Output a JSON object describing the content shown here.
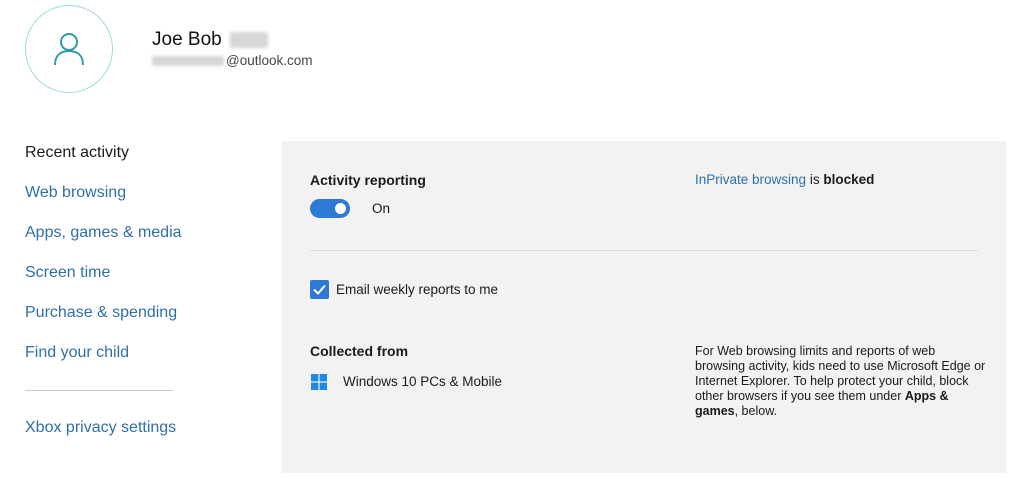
{
  "profile": {
    "name": "Joe Bob",
    "email_domain": "@outlook.com"
  },
  "sidebar": {
    "items": [
      {
        "label": "Recent activity",
        "active": true
      },
      {
        "label": "Web browsing"
      },
      {
        "label": "Apps, games & media"
      },
      {
        "label": "Screen time"
      },
      {
        "label": "Purchase & spending"
      },
      {
        "label": "Find your child"
      }
    ],
    "footer_link": "Xbox privacy settings"
  },
  "activity_reporting": {
    "title": "Activity reporting",
    "toggle_state": "On"
  },
  "inprivate": {
    "link": "InPrivate browsing",
    "middle": " is ",
    "status": "blocked"
  },
  "email_reports": {
    "label": "Email weekly reports to me",
    "checked": true
  },
  "collected_from": {
    "title": "Collected from",
    "device": "Windows 10 PCs & Mobile"
  },
  "info": {
    "text_before": "For Web browsing limits and reports of web browsing activity, kids need to use Microsoft Edge or Internet Explorer. To help protect your child, block other browsers if you see them under ",
    "bold": "Apps & games",
    "text_after": ", below."
  },
  "colors": {
    "accent": "#2e78d6",
    "link": "#2f6fa8",
    "panel_bg": "#f2f2f2",
    "avatar_ring": "#9fd8df",
    "windows_logo": "#1e88e5"
  },
  "icons": {
    "avatar": "person-icon",
    "checkbox": "checkmark-icon",
    "device": "windows-logo-icon"
  }
}
